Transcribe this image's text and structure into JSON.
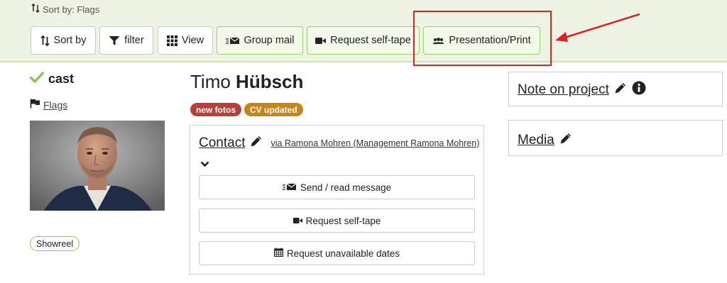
{
  "toolbar": {
    "sort_info": "Sort by: Flags",
    "sort_by": "Sort by",
    "filter": "filter",
    "view": "View",
    "group_mail": "Group mail",
    "request_self_tape": "Request self-tape",
    "presentation_print": "Presentation/Print"
  },
  "left": {
    "cast_label": "cast",
    "flags_label": "Flags",
    "showreel": "Showreel"
  },
  "profile": {
    "first_name": "Timo",
    "last_name": "Hübsch",
    "badges": [
      {
        "label": "new fotos",
        "color": "#b5413a"
      },
      {
        "label": "CV updated",
        "color": "#c8841a"
      }
    ]
  },
  "contact": {
    "title": "Contact",
    "via": "via Ramona Mohren (Management Ramona Mohren)",
    "buttons": {
      "send_message": "Send / read message",
      "request_self_tape": "Request self-tape",
      "request_unavailable": "Request unavailable dates"
    }
  },
  "right": {
    "note_title": "Note on project",
    "media_title": "Media"
  },
  "colors": {
    "toolbar_bg": "#eef4e4",
    "green_accent": "#8cc35a",
    "annotation_red": "#e02020"
  },
  "icons": [
    "sort-icon",
    "filter-icon",
    "grid-icon",
    "mail-icon",
    "video-camera-icon",
    "people-icon",
    "check-icon",
    "flag-icon",
    "pencil-icon",
    "info-icon",
    "chevron-down-icon",
    "calendar-icon"
  ]
}
